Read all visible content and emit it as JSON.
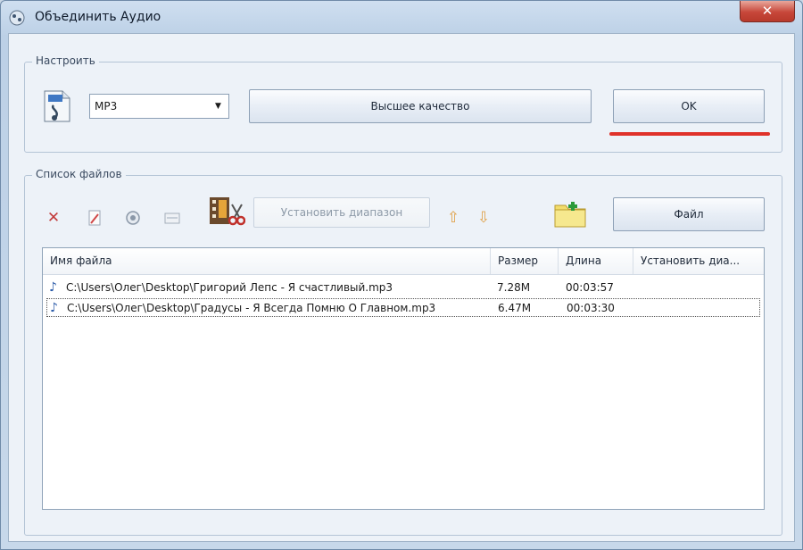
{
  "window": {
    "title": "Объединить Аудио",
    "close_label": "✕"
  },
  "settings": {
    "legend": "Настроить",
    "format_value": "MP3",
    "quality_button": "Высшее качество",
    "ok_button": "OK"
  },
  "files": {
    "legend": "Список файлов",
    "set_range_button": "Установить диапазон",
    "files_button": "Файл",
    "columns": [
      "Имя файла",
      "Размер",
      "Длина",
      "Установить диа..."
    ],
    "rows": [
      {
        "name": "C:\\Users\\Олег\\Desktop\\Григорий Лепс - Я счастливый.mp3",
        "size": "7.28M",
        "length": "00:03:57"
      },
      {
        "name": "C:\\Users\\Олег\\Desktop\\Градусы - Я Всегда Помню О Главном.mp3",
        "size": "6.47M",
        "length": "00:03:30"
      }
    ]
  },
  "colors": {
    "accent_underline": "#e0322a",
    "close_button": "#c7473a"
  }
}
